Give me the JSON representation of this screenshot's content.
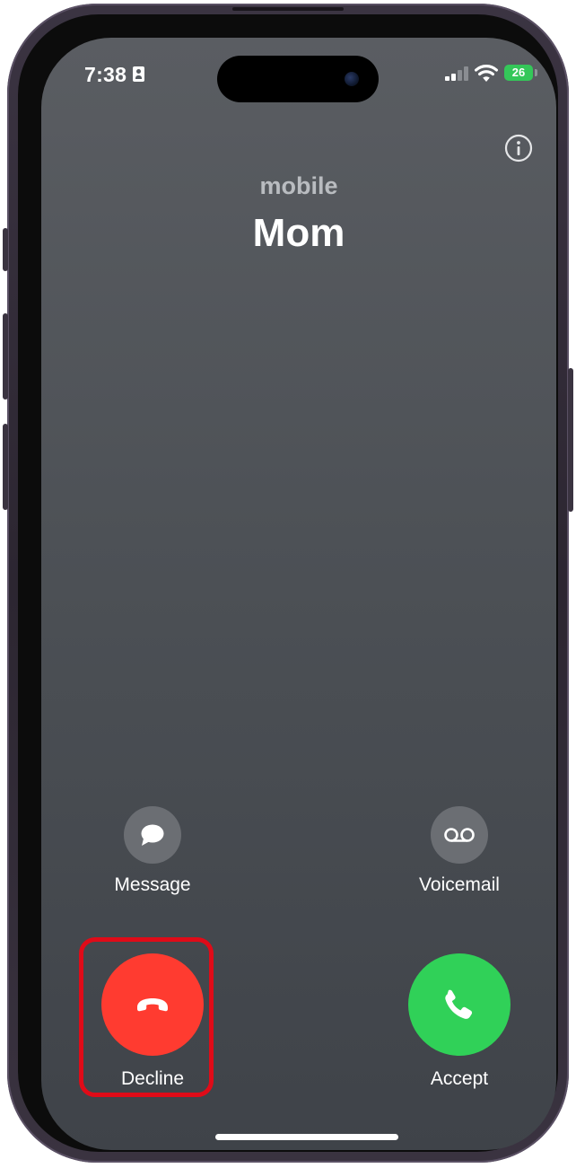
{
  "status_bar": {
    "time": "7:38",
    "battery_level": "26",
    "battery_color": "#34c759",
    "signal_bars": 2,
    "signal_total": 4
  },
  "caller": {
    "label": "mobile",
    "name": "Mom"
  },
  "actions": {
    "message_label": "Message",
    "voicemail_label": "Voicemail",
    "decline_label": "Decline",
    "accept_label": "Accept"
  },
  "colors": {
    "decline": "#ff3b30",
    "accept": "#30d158",
    "highlight": "#e00b18"
  },
  "icons": {
    "info": "info-circle-icon",
    "message": "message-bubble-icon",
    "voicemail": "voicemail-icon",
    "decline": "phone-down-icon",
    "accept": "phone-icon"
  }
}
